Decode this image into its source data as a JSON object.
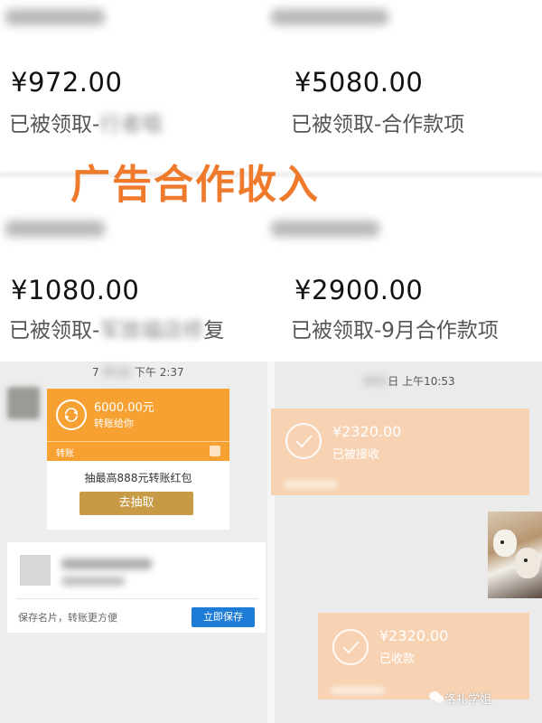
{
  "headline": "广告合作收入",
  "entries": [
    {
      "amount": "¥972.00",
      "prefix": "已被领取-",
      "suffix": ""
    },
    {
      "amount": "¥5080.00",
      "prefix": "已被领取-合作款项",
      "suffix": ""
    },
    {
      "amount": "¥1080.00",
      "prefix": "已被领取-",
      "suffix": "复"
    },
    {
      "amount": "¥2900.00",
      "prefix": "已被领取-9月合作款项",
      "suffix": ""
    }
  ],
  "chat_left": {
    "timestamp_suffix": "下午 2:37",
    "timestamp_prefix": "7",
    "transfer": {
      "amount": "6000.00元",
      "subtitle": "转账给你",
      "label": "转账"
    },
    "promo": {
      "text": "抽最高888元转账红包",
      "button": "去抽取"
    },
    "card": {
      "tip": "保存名片，转账更方便",
      "save_button": "立即保存"
    }
  },
  "chat_right": {
    "timestamp": "日 上午10:53",
    "receipts": [
      {
        "amount": "¥2320.00",
        "status": "已被接收"
      },
      {
        "amount": "¥2320.00",
        "status": "已收款"
      }
    ]
  },
  "watermark": "洛扎学姐",
  "colors": {
    "headline": "#f07a2c",
    "transfer": "#f7a133",
    "received": "#f8d3b3",
    "save_button": "#1f7cd6",
    "promo_button": "#c79a45"
  }
}
